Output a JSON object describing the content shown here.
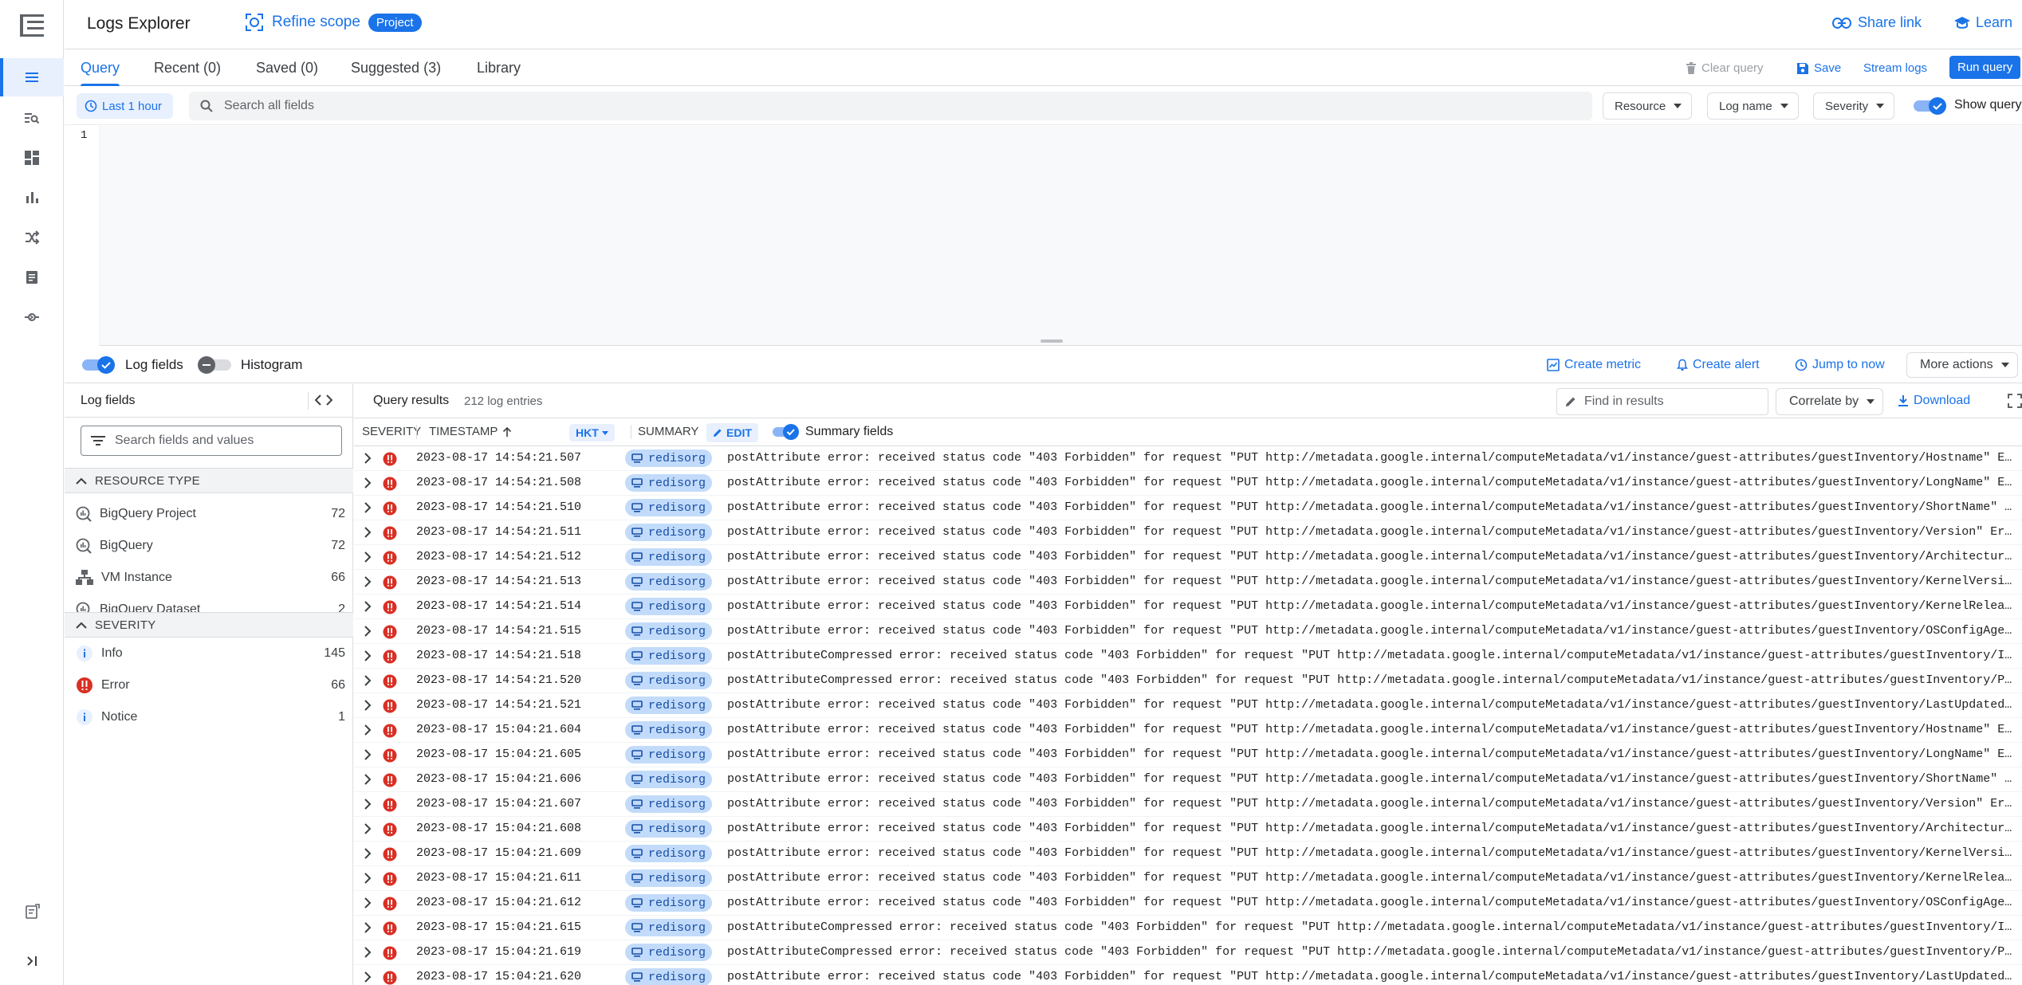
{
  "header": {
    "title": "Logs Explorer",
    "refine_scope": "Refine scope",
    "project_pill": "Project",
    "share_link": "Share link",
    "learn": "Learn"
  },
  "tabs": [
    {
      "label": "Query",
      "active": true
    },
    {
      "label": "Recent (0)"
    },
    {
      "label": "Saved (0)"
    },
    {
      "label": "Suggested (3)"
    },
    {
      "label": "Library"
    }
  ],
  "tab_actions": {
    "clear_query": "Clear query",
    "save": "Save",
    "stream_logs": "Stream logs",
    "run_query": "Run query"
  },
  "query_toolbar": {
    "time_range": "Last 1 hour",
    "search_placeholder": "Search all fields",
    "resource": "Resource",
    "log_name": "Log name",
    "severity": "Severity",
    "show_query": "Show query"
  },
  "editor": {
    "line_number": "1"
  },
  "results_bar": {
    "log_fields": "Log fields",
    "histogram": "Histogram",
    "create_metric": "Create metric",
    "create_alert": "Create alert",
    "jump_to_now": "Jump to now",
    "more_actions": "More actions"
  },
  "fields_panel": {
    "title": "Log fields",
    "search_placeholder": "Search fields and values",
    "resource_type_label": "RESOURCE TYPE",
    "resource_types": [
      {
        "name": "BigQuery Project",
        "count": "72"
      },
      {
        "name": "BigQuery",
        "count": "72"
      },
      {
        "name": "VM Instance",
        "count": "66"
      },
      {
        "name": "BigQuery Dataset",
        "count": "2"
      }
    ],
    "severity_label": "SEVERITY",
    "severities": [
      {
        "name": "Info",
        "count": "145",
        "kind": "info"
      },
      {
        "name": "Error",
        "count": "66",
        "kind": "error"
      },
      {
        "name": "Notice",
        "count": "1",
        "kind": "info"
      }
    ]
  },
  "results": {
    "title": "Query results",
    "count": "212 log entries",
    "find_placeholder": "Find in results",
    "correlate_by": "Correlate by",
    "download": "Download",
    "columns": {
      "severity": "SEVERITY",
      "timestamp": "TIMESTAMP",
      "timezone": "HKT",
      "summary": "SUMMARY",
      "edit": "EDIT",
      "summary_fields": "Summary fields"
    },
    "rows": [
      {
        "ts": "2023-08-17 14:54:21.507",
        "tag": "redisorg",
        "summary": "postAttribute error: received status code \"403 Forbidden\" for request \"PUT http://metadata.google.internal/computeMetadata/v1/instance/guest-attributes/guestInventory/Hostname\" E…"
      },
      {
        "ts": "2023-08-17 14:54:21.508",
        "tag": "redisorg",
        "summary": "postAttribute error: received status code \"403 Forbidden\" for request \"PUT http://metadata.google.internal/computeMetadata/v1/instance/guest-attributes/guestInventory/LongName\" E…"
      },
      {
        "ts": "2023-08-17 14:54:21.510",
        "tag": "redisorg",
        "summary": "postAttribute error: received status code \"403 Forbidden\" for request \"PUT http://metadata.google.internal/computeMetadata/v1/instance/guest-attributes/guestInventory/ShortName\" …"
      },
      {
        "ts": "2023-08-17 14:54:21.511",
        "tag": "redisorg",
        "summary": "postAttribute error: received status code \"403 Forbidden\" for request \"PUT http://metadata.google.internal/computeMetadata/v1/instance/guest-attributes/guestInventory/Version\" Er…"
      },
      {
        "ts": "2023-08-17 14:54:21.512",
        "tag": "redisorg",
        "summary": "postAttribute error: received status code \"403 Forbidden\" for request \"PUT http://metadata.google.internal/computeMetadata/v1/instance/guest-attributes/guestInventory/Architectur…"
      },
      {
        "ts": "2023-08-17 14:54:21.513",
        "tag": "redisorg",
        "summary": "postAttribute error: received status code \"403 Forbidden\" for request \"PUT http://metadata.google.internal/computeMetadata/v1/instance/guest-attributes/guestInventory/KernelVersi…"
      },
      {
        "ts": "2023-08-17 14:54:21.514",
        "tag": "redisorg",
        "summary": "postAttribute error: received status code \"403 Forbidden\" for request \"PUT http://metadata.google.internal/computeMetadata/v1/instance/guest-attributes/guestInventory/KernelRelea…"
      },
      {
        "ts": "2023-08-17 14:54:21.515",
        "tag": "redisorg",
        "summary": "postAttribute error: received status code \"403 Forbidden\" for request \"PUT http://metadata.google.internal/computeMetadata/v1/instance/guest-attributes/guestInventory/OSConfigAge…"
      },
      {
        "ts": "2023-08-17 14:54:21.518",
        "tag": "redisorg",
        "summary": "postAttributeCompressed error: received status code \"403 Forbidden\" for request \"PUT http://metadata.google.internal/computeMetadata/v1/instance/guest-attributes/guestInventory/I…"
      },
      {
        "ts": "2023-08-17 14:54:21.520",
        "tag": "redisorg",
        "summary": "postAttributeCompressed error: received status code \"403 Forbidden\" for request \"PUT http://metadata.google.internal/computeMetadata/v1/instance/guest-attributes/guestInventory/P…"
      },
      {
        "ts": "2023-08-17 14:54:21.521",
        "tag": "redisorg",
        "summary": "postAttribute error: received status code \"403 Forbidden\" for request \"PUT http://metadata.google.internal/computeMetadata/v1/instance/guest-attributes/guestInventory/LastUpdated…"
      },
      {
        "ts": "2023-08-17 15:04:21.604",
        "tag": "redisorg",
        "summary": "postAttribute error: received status code \"403 Forbidden\" for request \"PUT http://metadata.google.internal/computeMetadata/v1/instance/guest-attributes/guestInventory/Hostname\" E…"
      },
      {
        "ts": "2023-08-17 15:04:21.605",
        "tag": "redisorg",
        "summary": "postAttribute error: received status code \"403 Forbidden\" for request \"PUT http://metadata.google.internal/computeMetadata/v1/instance/guest-attributes/guestInventory/LongName\" E…"
      },
      {
        "ts": "2023-08-17 15:04:21.606",
        "tag": "redisorg",
        "summary": "postAttribute error: received status code \"403 Forbidden\" for request \"PUT http://metadata.google.internal/computeMetadata/v1/instance/guest-attributes/guestInventory/ShortName\" …"
      },
      {
        "ts": "2023-08-17 15:04:21.607",
        "tag": "redisorg",
        "summary": "postAttribute error: received status code \"403 Forbidden\" for request \"PUT http://metadata.google.internal/computeMetadata/v1/instance/guest-attributes/guestInventory/Version\" Er…"
      },
      {
        "ts": "2023-08-17 15:04:21.608",
        "tag": "redisorg",
        "summary": "postAttribute error: received status code \"403 Forbidden\" for request \"PUT http://metadata.google.internal/computeMetadata/v1/instance/guest-attributes/guestInventory/Architectur…"
      },
      {
        "ts": "2023-08-17 15:04:21.609",
        "tag": "redisorg",
        "summary": "postAttribute error: received status code \"403 Forbidden\" for request \"PUT http://metadata.google.internal/computeMetadata/v1/instance/guest-attributes/guestInventory/KernelVersi…"
      },
      {
        "ts": "2023-08-17 15:04:21.611",
        "tag": "redisorg",
        "summary": "postAttribute error: received status code \"403 Forbidden\" for request \"PUT http://metadata.google.internal/computeMetadata/v1/instance/guest-attributes/guestInventory/KernelRelea…"
      },
      {
        "ts": "2023-08-17 15:04:21.612",
        "tag": "redisorg",
        "summary": "postAttribute error: received status code \"403 Forbidden\" for request \"PUT http://metadata.google.internal/computeMetadata/v1/instance/guest-attributes/guestInventory/OSConfigAge…"
      },
      {
        "ts": "2023-08-17 15:04:21.615",
        "tag": "redisorg",
        "summary": "postAttributeCompressed error: received status code \"403 Forbidden\" for request \"PUT http://metadata.google.internal/computeMetadata/v1/instance/guest-attributes/guestInventory/I…"
      },
      {
        "ts": "2023-08-17 15:04:21.619",
        "tag": "redisorg",
        "summary": "postAttributeCompressed error: received status code \"403 Forbidden\" for request \"PUT http://metadata.google.internal/computeMetadata/v1/instance/guest-attributes/guestInventory/P…"
      },
      {
        "ts": "2023-08-17 15:04:21.620",
        "tag": "redisorg",
        "summary": "postAttribute error: received status code \"403 Forbidden\" for request \"PUT http://metadata.google.internal/computeMetadata/v1/instance/guest-attributes/guestInventory/LastUpdated…"
      }
    ]
  },
  "colors": {
    "accent": "#1a73e8",
    "error": "#d93025",
    "chip_bg": "#e8f0fe",
    "tag_bg": "#c2dbfa"
  },
  "icons": {
    "rail": [
      "hamburger-menu-icon",
      "logs-list-icon",
      "log-search-icon",
      "dashboard-icon",
      "bar-chart-icon",
      "shuffle-icon",
      "document-icon",
      "pipeline-icon",
      "release-notes-icon",
      "expand-rail-icon"
    ]
  }
}
